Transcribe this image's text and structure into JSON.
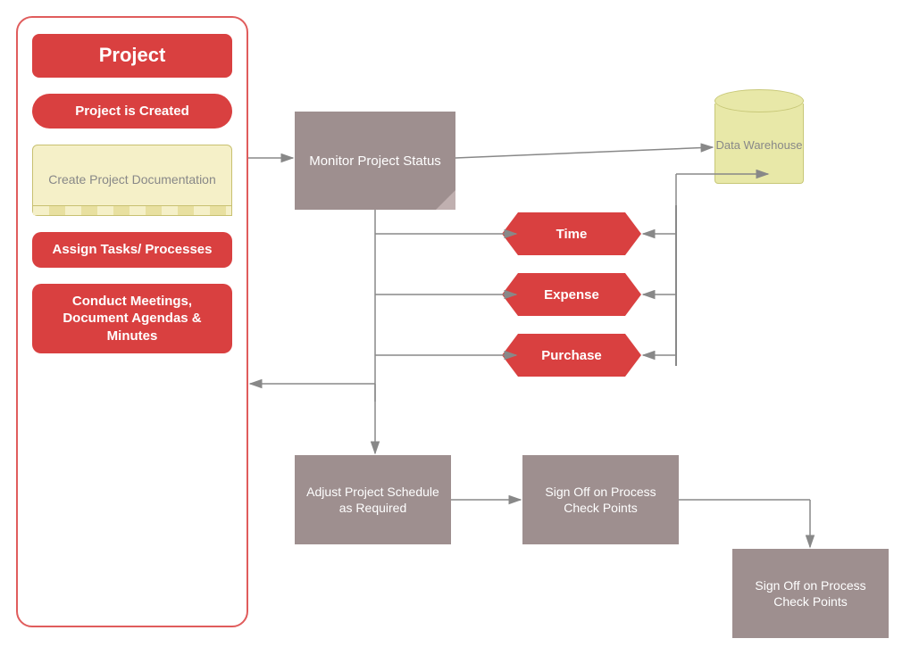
{
  "left_panel": {
    "title": "Project",
    "item1": "Project is Created",
    "item2": "Create Project Documentation",
    "item3": "Assign Tasks/ Processes",
    "item4": "Conduct Meetings, Document Agendas & Minutes"
  },
  "flow": {
    "monitor": "Monitor Project Status",
    "data_warehouse": "Data Warehouse",
    "time": "Time",
    "expense": "Expense",
    "purchase": "Purchase",
    "adjust": "Adjust Project Schedule as Required",
    "signoff1": "Sign Off on Process Check Points",
    "signoff2": "Sign Off on Process Check Points"
  },
  "colors": {
    "red": "#d94040",
    "gray": "#9e8f8f",
    "dark_gray": "#7a6e6e",
    "cyl_fill": "#e8e8a8",
    "cyl_border": "#c8c878",
    "doc_fill": "#f5f0c8",
    "panel_border": "#e05c5c"
  }
}
